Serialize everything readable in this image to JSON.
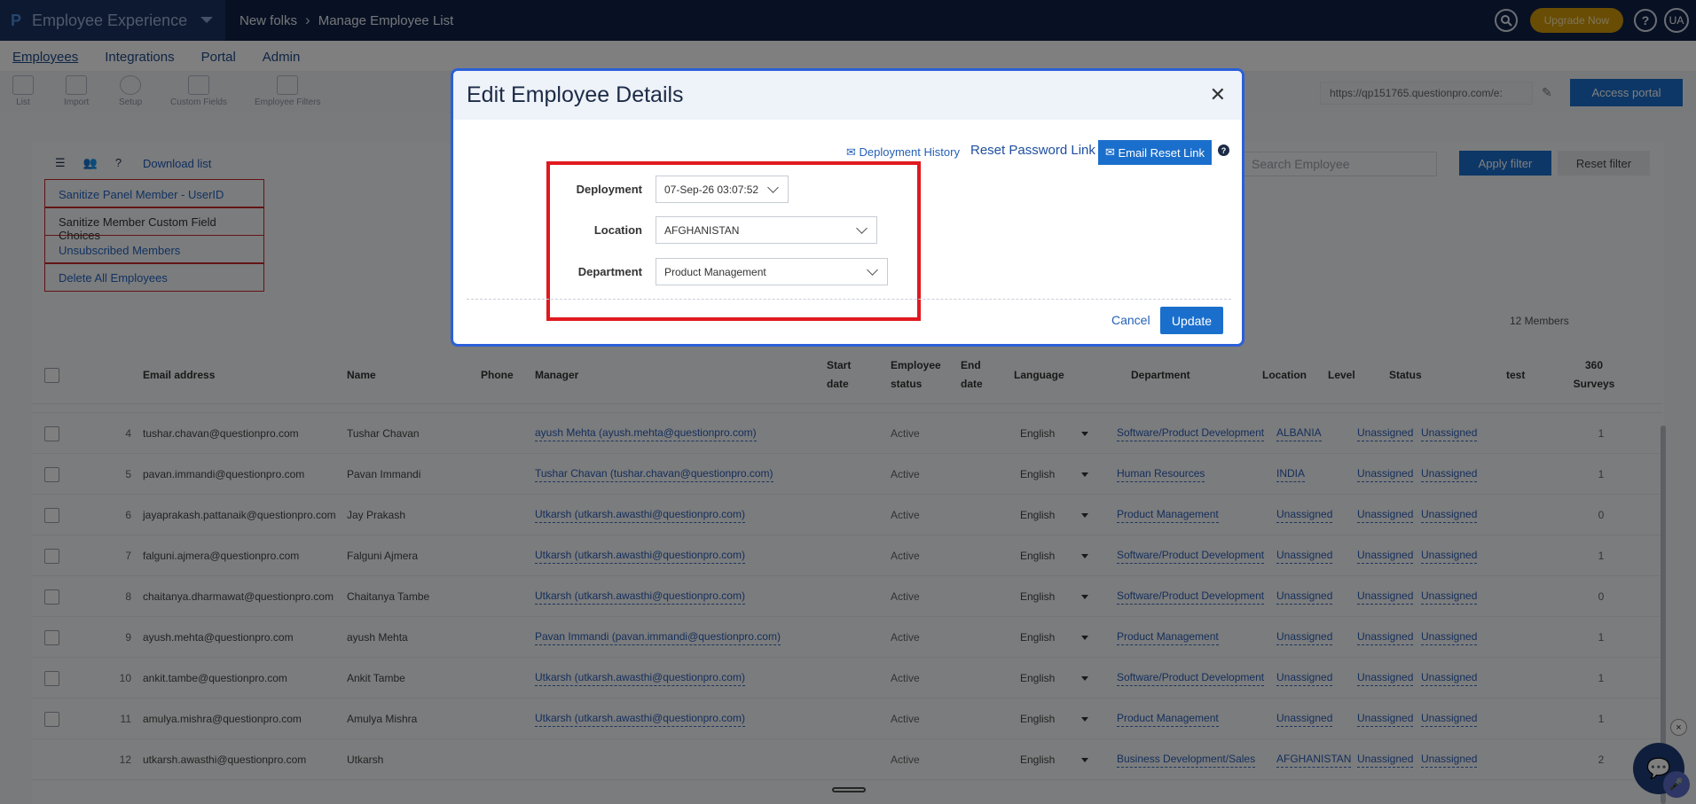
{
  "topbar": {
    "app_name": "Employee Experience",
    "breadcrumb": [
      "New folks",
      "Manage Employee List"
    ],
    "upgrade_label": "Upgrade Now",
    "help_label": "?",
    "avatar_initials": "UA"
  },
  "subnav": [
    "Employees",
    "Integrations",
    "Portal",
    "Admin"
  ],
  "toolbar": {
    "items": [
      "List",
      "Import",
      "Setup",
      "Custom Fields",
      "Employee Filters"
    ],
    "portal_url": "https://qp151765.questionpro.com/e:",
    "access_portal_label": "Access portal"
  },
  "list_controls": {
    "download_label": "Download list",
    "menu_items": [
      "Sanitize Panel Member - UserID",
      "Sanitize Member Custom Field Choices",
      "Unsubscribed Members",
      "Delete All Employees"
    ],
    "search_placeholder": "Search Employee",
    "apply_filter_label": "Apply filter",
    "reset_filter_label": "Reset filter",
    "members_count": "12 Members"
  },
  "table": {
    "headers": {
      "email": "Email address",
      "name": "Name",
      "phone": "Phone",
      "manager": "Manager",
      "start": "Start date",
      "emp_status": "Employee status",
      "end": "End date",
      "language": "Language",
      "department": "Department",
      "location": "Location",
      "level": "Level",
      "status": "Status",
      "test": "test",
      "surveys": "360 Surveys"
    },
    "rows": [
      {
        "num": "4",
        "email": "tushar.chavan@questionpro.com",
        "name": "Tushar Chavan",
        "manager": "ayush Mehta (ayush.mehta@questionpro.com)",
        "emp_status": "Active",
        "language": "English",
        "department": "Software/Product Development",
        "location": "ALBANIA",
        "level": "Unassigned",
        "status": "Unassigned",
        "surveys": "1"
      },
      {
        "num": "5",
        "email": "pavan.immandi@questionpro.com",
        "name": "Pavan Immandi",
        "manager": "Tushar Chavan (tushar.chavan@questionpro.com)",
        "emp_status": "Active",
        "language": "English",
        "department": "Human Resources",
        "location": "INDIA",
        "level": "Unassigned",
        "status": "Unassigned",
        "surveys": "1"
      },
      {
        "num": "6",
        "email": "jayaprakash.pattanaik@questionpro.com",
        "name": "Jay Prakash",
        "manager": "Utkarsh (utkarsh.awasthi@questionpro.com)",
        "emp_status": "Active",
        "language": "English",
        "department": "Product Management",
        "location": "Unassigned",
        "level": "Unassigned",
        "status": "Unassigned",
        "surveys": "0"
      },
      {
        "num": "7",
        "email": "falguni.ajmera@questionpro.com",
        "name": "Falguni Ajmera",
        "manager": "Utkarsh (utkarsh.awasthi@questionpro.com)",
        "emp_status": "Active",
        "language": "English",
        "department": "Software/Product Development",
        "location": "Unassigned",
        "level": "Unassigned",
        "status": "Unassigned",
        "surveys": "1"
      },
      {
        "num": "8",
        "email": "chaitanya.dharmawat@questionpro.com",
        "name": "Chaitanya Tambe",
        "manager": "Utkarsh (utkarsh.awasthi@questionpro.com)",
        "emp_status": "Active",
        "language": "English",
        "department": "Software/Product Development",
        "location": "Unassigned",
        "level": "Unassigned",
        "status": "Unassigned",
        "surveys": "0"
      },
      {
        "num": "9",
        "email": "ayush.mehta@questionpro.com",
        "name": "ayush Mehta",
        "manager": "Pavan Immandi (pavan.immandi@questionpro.com)",
        "emp_status": "Active",
        "language": "English",
        "department": "Product Management",
        "location": "Unassigned",
        "level": "Unassigned",
        "status": "Unassigned",
        "surveys": "1"
      },
      {
        "num": "10",
        "email": "ankit.tambe@questionpro.com",
        "name": "Ankit Tambe",
        "manager": "Utkarsh (utkarsh.awasthi@questionpro.com)",
        "emp_status": "Active",
        "language": "English",
        "department": "Software/Product Development",
        "location": "Unassigned",
        "level": "Unassigned",
        "status": "Unassigned",
        "surveys": "1"
      },
      {
        "num": "11",
        "email": "amulya.mishra@questionpro.com",
        "name": "Amulya Mishra",
        "manager": "Utkarsh (utkarsh.awasthi@questionpro.com)",
        "emp_status": "Active",
        "language": "English",
        "department": "Product Management",
        "location": "Unassigned",
        "level": "Unassigned",
        "status": "Unassigned",
        "surveys": "1"
      },
      {
        "num": "12",
        "email": "utkarsh.awasthi@questionpro.com",
        "name": "Utkarsh",
        "manager": "",
        "emp_status": "Active",
        "language": "English",
        "department": "Business Development/Sales",
        "location": "AFGHANISTAN",
        "level": "Unassigned",
        "status": "Unassigned",
        "surveys": "2"
      }
    ]
  },
  "modal": {
    "title": "Edit Employee Details",
    "deployment_history_label": "Deployment History",
    "reset_password_label": "Reset Password Link",
    "email_reset_label": "Email Reset Link",
    "deployment_label": "Deployment",
    "deployment_value": "07-Sep-26 03:07:52",
    "location_label": "Location",
    "location_value": "AFGHANISTAN",
    "department_label": "Department",
    "department_value": "Product Management",
    "cancel_label": "Cancel",
    "update_label": "Update"
  },
  "colors": {
    "topbar": "#102246",
    "accent": "#1b6fcc",
    "highlight": "#e0191f",
    "modal_border": "#2a5fd8"
  }
}
